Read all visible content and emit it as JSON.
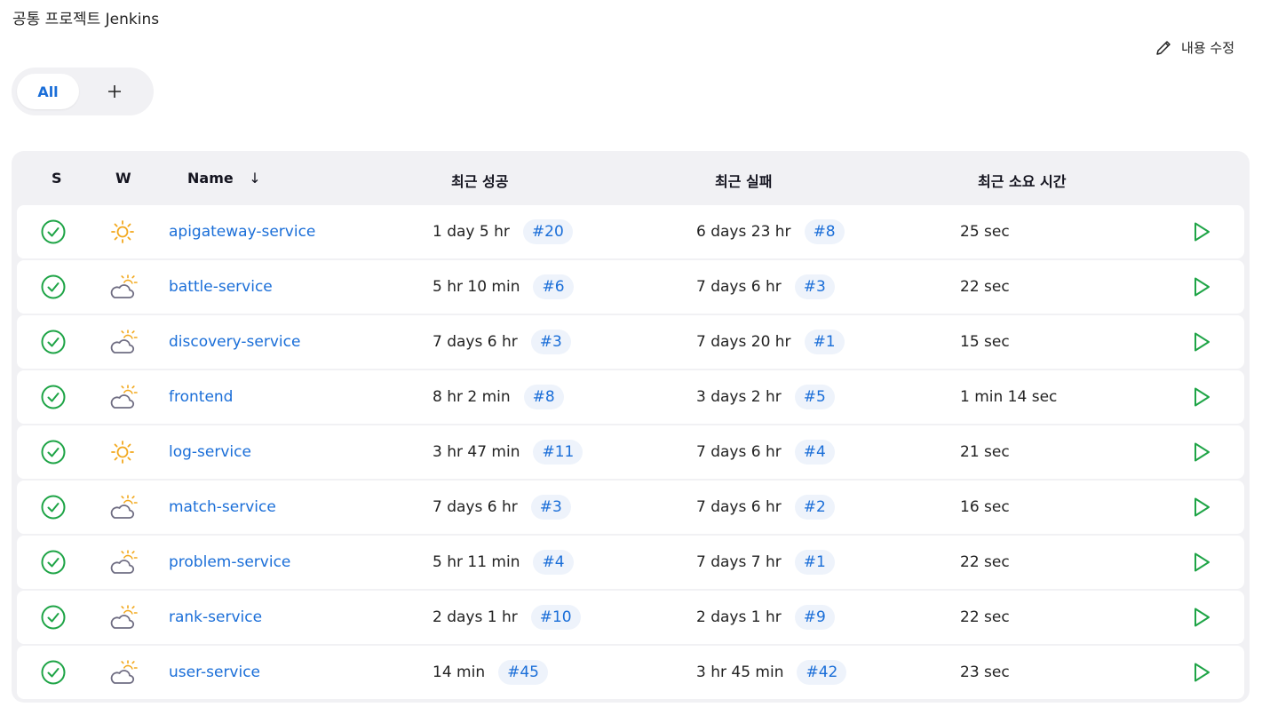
{
  "page": {
    "title": "공통 프로젝트 Jenkins",
    "edit_description": "내용 수정"
  },
  "tabs": {
    "all_label": "All",
    "add_label": "+"
  },
  "table": {
    "headers": {
      "s": "S",
      "w": "W",
      "name": "Name",
      "sort_indicator": "↓",
      "last_success": "최근 성공",
      "last_failure": "최근 실패",
      "last_duration": "최근 소요 시간"
    },
    "rows": [
      {
        "name": "apigateway-service",
        "status": "success",
        "weather": "sunny",
        "success_time": "1 day 5 hr",
        "success_build": "#20",
        "failure_time": "6 days 23 hr",
        "failure_build": "#8",
        "duration": "25 sec"
      },
      {
        "name": "battle-service",
        "status": "success",
        "weather": "cloudy",
        "success_time": "5 hr 10 min",
        "success_build": "#6",
        "failure_time": "7 days 6 hr",
        "failure_build": "#3",
        "duration": "22 sec"
      },
      {
        "name": "discovery-service",
        "status": "success",
        "weather": "cloudy",
        "success_time": "7 days 6 hr",
        "success_build": "#3",
        "failure_time": "7 days 20 hr",
        "failure_build": "#1",
        "duration": "15 sec"
      },
      {
        "name": "frontend",
        "status": "success",
        "weather": "cloudy",
        "success_time": "8 hr 2 min",
        "success_build": "#8",
        "failure_time": "3 days 2 hr",
        "failure_build": "#5",
        "duration": "1 min 14 sec"
      },
      {
        "name": "log-service",
        "status": "success",
        "weather": "sunny",
        "success_time": "3 hr 47 min",
        "success_build": "#11",
        "failure_time": "7 days 6 hr",
        "failure_build": "#4",
        "duration": "21 sec"
      },
      {
        "name": "match-service",
        "status": "success",
        "weather": "cloudy",
        "success_time": "7 days 6 hr",
        "success_build": "#3",
        "failure_time": "7 days 6 hr",
        "failure_build": "#2",
        "duration": "16 sec"
      },
      {
        "name": "problem-service",
        "status": "success",
        "weather": "cloudy",
        "success_time": "5 hr 11 min",
        "success_build": "#4",
        "failure_time": "7 days 7 hr",
        "failure_build": "#1",
        "duration": "22 sec"
      },
      {
        "name": "rank-service",
        "status": "success",
        "weather": "cloudy",
        "success_time": "2 days 1 hr",
        "success_build": "#10",
        "failure_time": "2 days 1 hr",
        "failure_build": "#9",
        "duration": "22 sec"
      },
      {
        "name": "user-service",
        "status": "success",
        "weather": "cloudy",
        "success_time": "14 min",
        "success_build": "#45",
        "failure_time": "3 hr 45 min",
        "failure_build": "#42",
        "duration": "23 sec"
      }
    ]
  },
  "colors": {
    "accent": "#1a6ed8",
    "success": "#1ea446",
    "sun": "#f2a81d",
    "cloud": "#6f6d82",
    "panel": "#f1f1f4"
  }
}
